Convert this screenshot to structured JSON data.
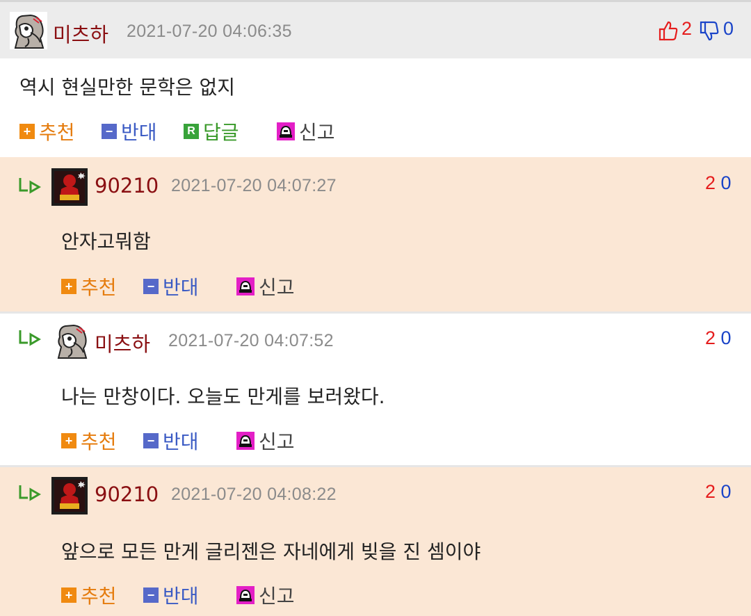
{
  "top_comment": {
    "nickname": "미츠하",
    "datetime": "2021-07-20 04:06:35",
    "upvotes": "2",
    "downvotes": "0",
    "text": "역시 현실만한 문학은 없지",
    "actions": {
      "recommend": "추천",
      "oppose": "반대",
      "reply": "답글",
      "report": "신고"
    }
  },
  "replies": [
    {
      "nickname": "90210",
      "datetime": "2021-07-20 04:07:27",
      "upvotes": "2",
      "downvotes": "0",
      "text": "안자고뭐함",
      "recommend": "추천",
      "oppose": "반대",
      "report": "신고"
    },
    {
      "nickname": "미츠하",
      "datetime": "2021-07-20 04:07:52",
      "upvotes": "2",
      "downvotes": "0",
      "text": "나는 만창이다. 오늘도 만게를 보러왔다.",
      "recommend": "추천",
      "oppose": "반대",
      "report": "신고"
    },
    {
      "nickname": "90210",
      "datetime": "2021-07-20 04:08:22",
      "upvotes": "2",
      "downvotes": "0",
      "text": "앞으로 모든 만게 글리젠은 자네에게 빚을 진 셈이야",
      "recommend": "추천",
      "oppose": "반대",
      "report": "신고"
    }
  ],
  "icons": {
    "thumbs_up": "thumbs-up-icon",
    "thumbs_down": "thumbs-down-icon",
    "recommend": "plus-icon",
    "oppose": "minus-icon",
    "reply": "reply-r-icon",
    "report": "siren-icon",
    "reply_arrow": "reply-arrow-icon"
  },
  "colors": {
    "nickname": "#8a0f12",
    "recommend": "#f08a10",
    "oppose": "#5669c9",
    "reply": "#38a33a",
    "report": "#e31fc6",
    "upvote": "#e51d1d",
    "downvote": "#1a44c8",
    "reply_bg": "#fbe7d5"
  }
}
